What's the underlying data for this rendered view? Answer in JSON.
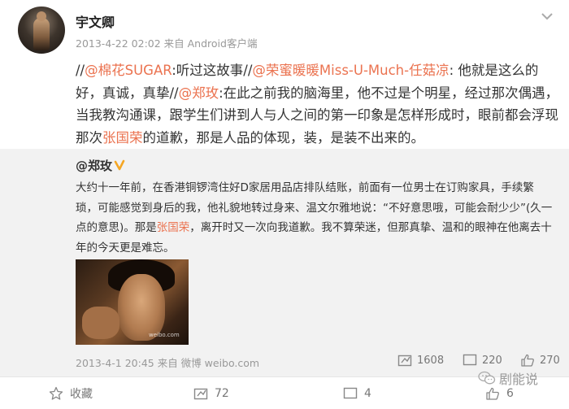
{
  "post": {
    "username": "宇文卿",
    "meta": "2013-4-22 02:02 来自 Android客户端",
    "text_parts": [
      {
        "t": "//",
        "c": "n"
      },
      {
        "t": "@棉花SUGAR",
        "c": "m"
      },
      {
        "t": ":听过这故事//",
        "c": "n"
      },
      {
        "t": "@荣蜜暖暖Miss-U-Much-任菇凉",
        "c": "m"
      },
      {
        "t": ": 他就是这么的好，真诚，真挚//",
        "c": "n"
      },
      {
        "t": "@郑玫",
        "c": "m"
      },
      {
        "t": ":在此之前我的脑海里，他不过是个明星，经过那次偶遇，当我教沟通课，跟学生们讲到人与人之间的第一印象是怎样形成时，眼前都会浮现那次",
        "c": "n"
      },
      {
        "t": "张国荣",
        "c": "m"
      },
      {
        "t": "的道歉，那是人品的体现，装，是装不出来的。",
        "c": "n"
      }
    ]
  },
  "repost": {
    "username": "@郑玫",
    "text_parts": [
      {
        "t": "大约十一年前，在香港铜锣湾住好D家居用品店排队结账，前面有一位男士在订购家具，手续繁琐，可能感觉到身后的我，他礼貌地转过身来、温文尔雅地说：“不好意思哦，可能会耐少少”(久一点的意思)。那是",
        "c": "n"
      },
      {
        "t": "张国荣",
        "c": "m"
      },
      {
        "t": "，离开时又一次向我道歉。我不算荣迷，但那真挚、温和的眼神在他离去十年的今天更是难忘。",
        "c": "n"
      }
    ],
    "photo_watermark": "weibo.com",
    "meta": "2013-4-1 20:45 来自 微博 weibo.com",
    "reposts": "1608",
    "comments": "220",
    "likes": "270"
  },
  "footer": {
    "favorite_label": "收藏",
    "repost_count": "72",
    "comment_count": "4",
    "like_count": "6"
  },
  "brand": {
    "label": "剧能说"
  },
  "colors": {
    "mention": "#eb7350",
    "repost_bg": "#f2f2f2",
    "meta": "#999999"
  },
  "icons": [
    "avatar",
    "more-chevron-icon",
    "verified-v-icon",
    "repost-icon",
    "comment-icon",
    "like-icon",
    "star-icon",
    "wechat-icon"
  ]
}
